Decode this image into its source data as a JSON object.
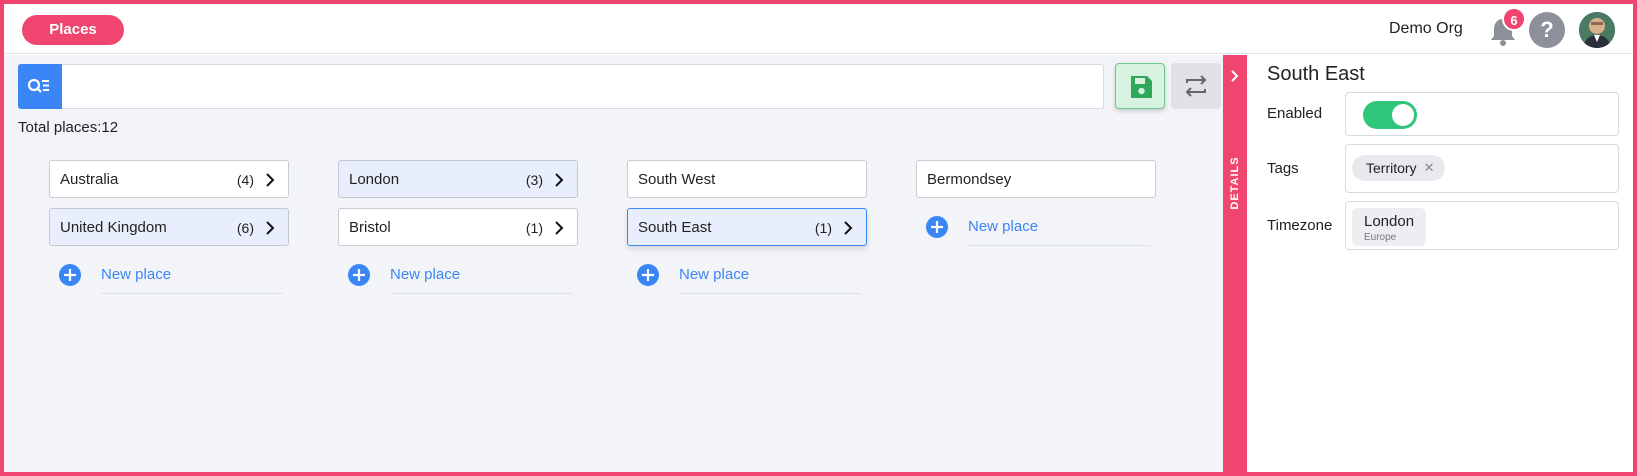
{
  "topbar": {
    "app_button": "Places",
    "org_name": "Demo Org",
    "notification_count": "6",
    "help_label": "?",
    "accent_color": "#f0456e"
  },
  "main": {
    "search": {
      "placeholder": "",
      "value": ""
    },
    "total_text": "Total places:12",
    "columns": [
      {
        "cards": [
          {
            "name": "Australia",
            "count": "(4)"
          },
          {
            "name": "United Kingdom",
            "count": "(6)"
          }
        ],
        "new_label": "New place"
      },
      {
        "cards": [
          {
            "name": "London",
            "count": "(3)"
          },
          {
            "name": "Bristol",
            "count": "(1)"
          }
        ],
        "new_label": "New place"
      },
      {
        "cards": [
          {
            "name": "South West"
          },
          {
            "name": "South East",
            "count": "(1)"
          }
        ],
        "new_label": "New place"
      },
      {
        "cards": [
          {
            "name": "Bermondsey"
          }
        ],
        "new_label": "New place"
      }
    ]
  },
  "details_tab": {
    "label": "DETAILS"
  },
  "details": {
    "title": "South East",
    "enabled_label": "Enabled",
    "enabled": true,
    "tags_label": "Tags",
    "tags": [
      "Territory"
    ],
    "timezone_label": "Timezone",
    "timezone": {
      "city": "London",
      "region": "Europe"
    }
  },
  "icons": {
    "search": "search-filter-icon",
    "save": "floppy-disk-icon",
    "swap": "swap-arrows-icon",
    "bell": "bell-icon",
    "chevron": "chevron-right-icon",
    "plus": "plus-circle-icon"
  }
}
